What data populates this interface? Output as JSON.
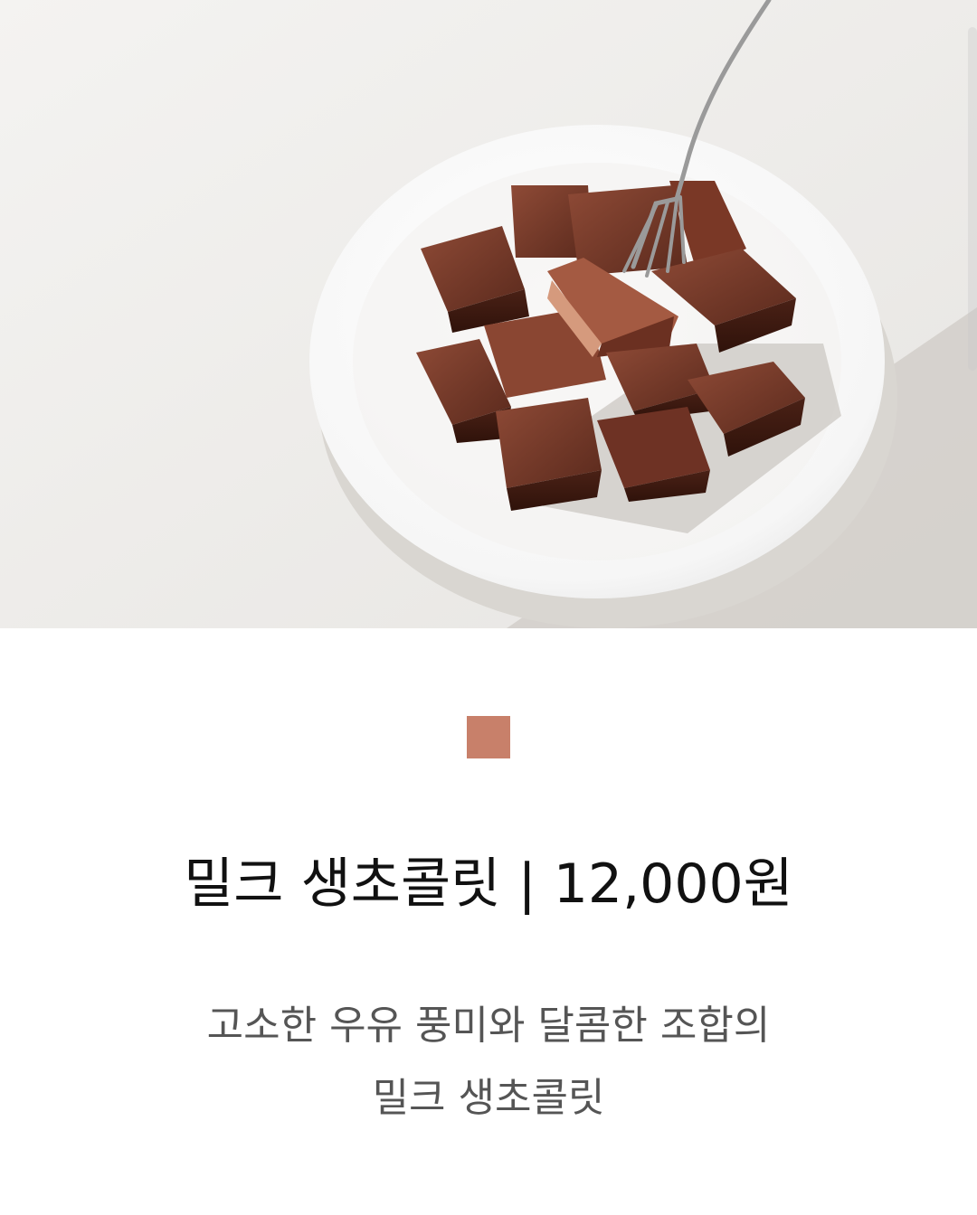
{
  "product": {
    "image_name": "milk-raw-chocolate-photo",
    "swatch_color": "#c8806a",
    "title": "밀크 생초콜릿 | 12,000원",
    "description_lines": [
      "고소한 우유 풍미와 달콤한 조합의",
      "밀크 생초콜릿"
    ]
  }
}
